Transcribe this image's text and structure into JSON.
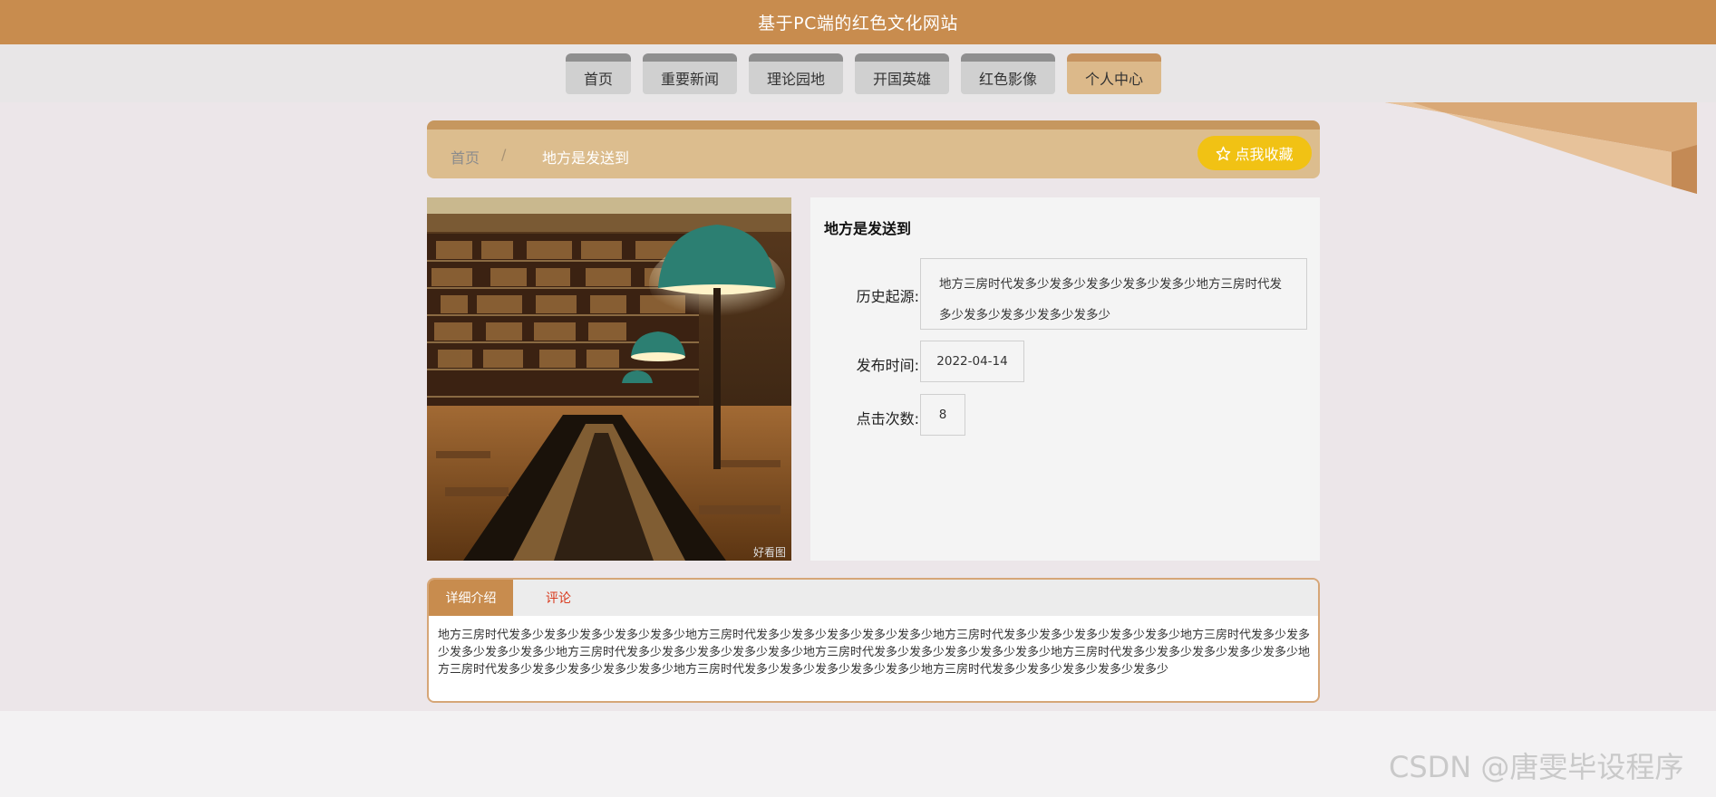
{
  "site": {
    "title": "基于PC端的红色文化网站"
  },
  "nav": {
    "items": [
      {
        "label": "首页",
        "active": false
      },
      {
        "label": "重要新闻",
        "active": false
      },
      {
        "label": "理论园地",
        "active": false
      },
      {
        "label": "开国英雄",
        "active": false
      },
      {
        "label": "红色影像",
        "active": false
      },
      {
        "label": "个人中心",
        "active": true
      }
    ]
  },
  "breadcrumb": {
    "home": "首页",
    "separator": "/",
    "current": "地方是发送到"
  },
  "favorite": {
    "icon": "star-outline-icon",
    "label": "点我收藏"
  },
  "photo": {
    "caption": "好看图"
  },
  "detail": {
    "title": "地方是发送到",
    "origin_label": "历史起源:",
    "origin_value": "地方三房时代发多少发多少发多少发多少发多少地方三房时代发多少发多少发多少发多少发多少",
    "date_label": "发布时间:",
    "date_value": "2022-04-14",
    "clicks_label": "点击次数:",
    "clicks_value": "8"
  },
  "tabs": {
    "detail_label": "详细介绍",
    "comment_label": "评论",
    "content": "地方三房时代发多少发多少发多少发多少发多少地方三房时代发多少发多少发多少发多少发多少地方三房时代发多少发多少发多少发多少发多少地方三房时代发多少发多少发多少发多少发多少地方三房时代发多少发多少发多少发多少发多少地方三房时代发多少发多少发多少发多少发多少地方三房时代发多少发多少发多少发多少发多少地方三房时代发多少发多少发多少发多少发多少地方三房时代发多少发多少发多少发多少发多少地方三房时代发多少发多少发多少发多少发多少"
  },
  "watermark": "CSDN @唐雯毕设程序",
  "colors": {
    "brand": "#c88c4e",
    "nav_tab": "#d0d0d0",
    "nav_active": "#dcb98a",
    "breadcrumb_bg": "#dcbd8e",
    "favorite_btn": "#f1c214",
    "comment_tab_text": "#d9391c"
  }
}
